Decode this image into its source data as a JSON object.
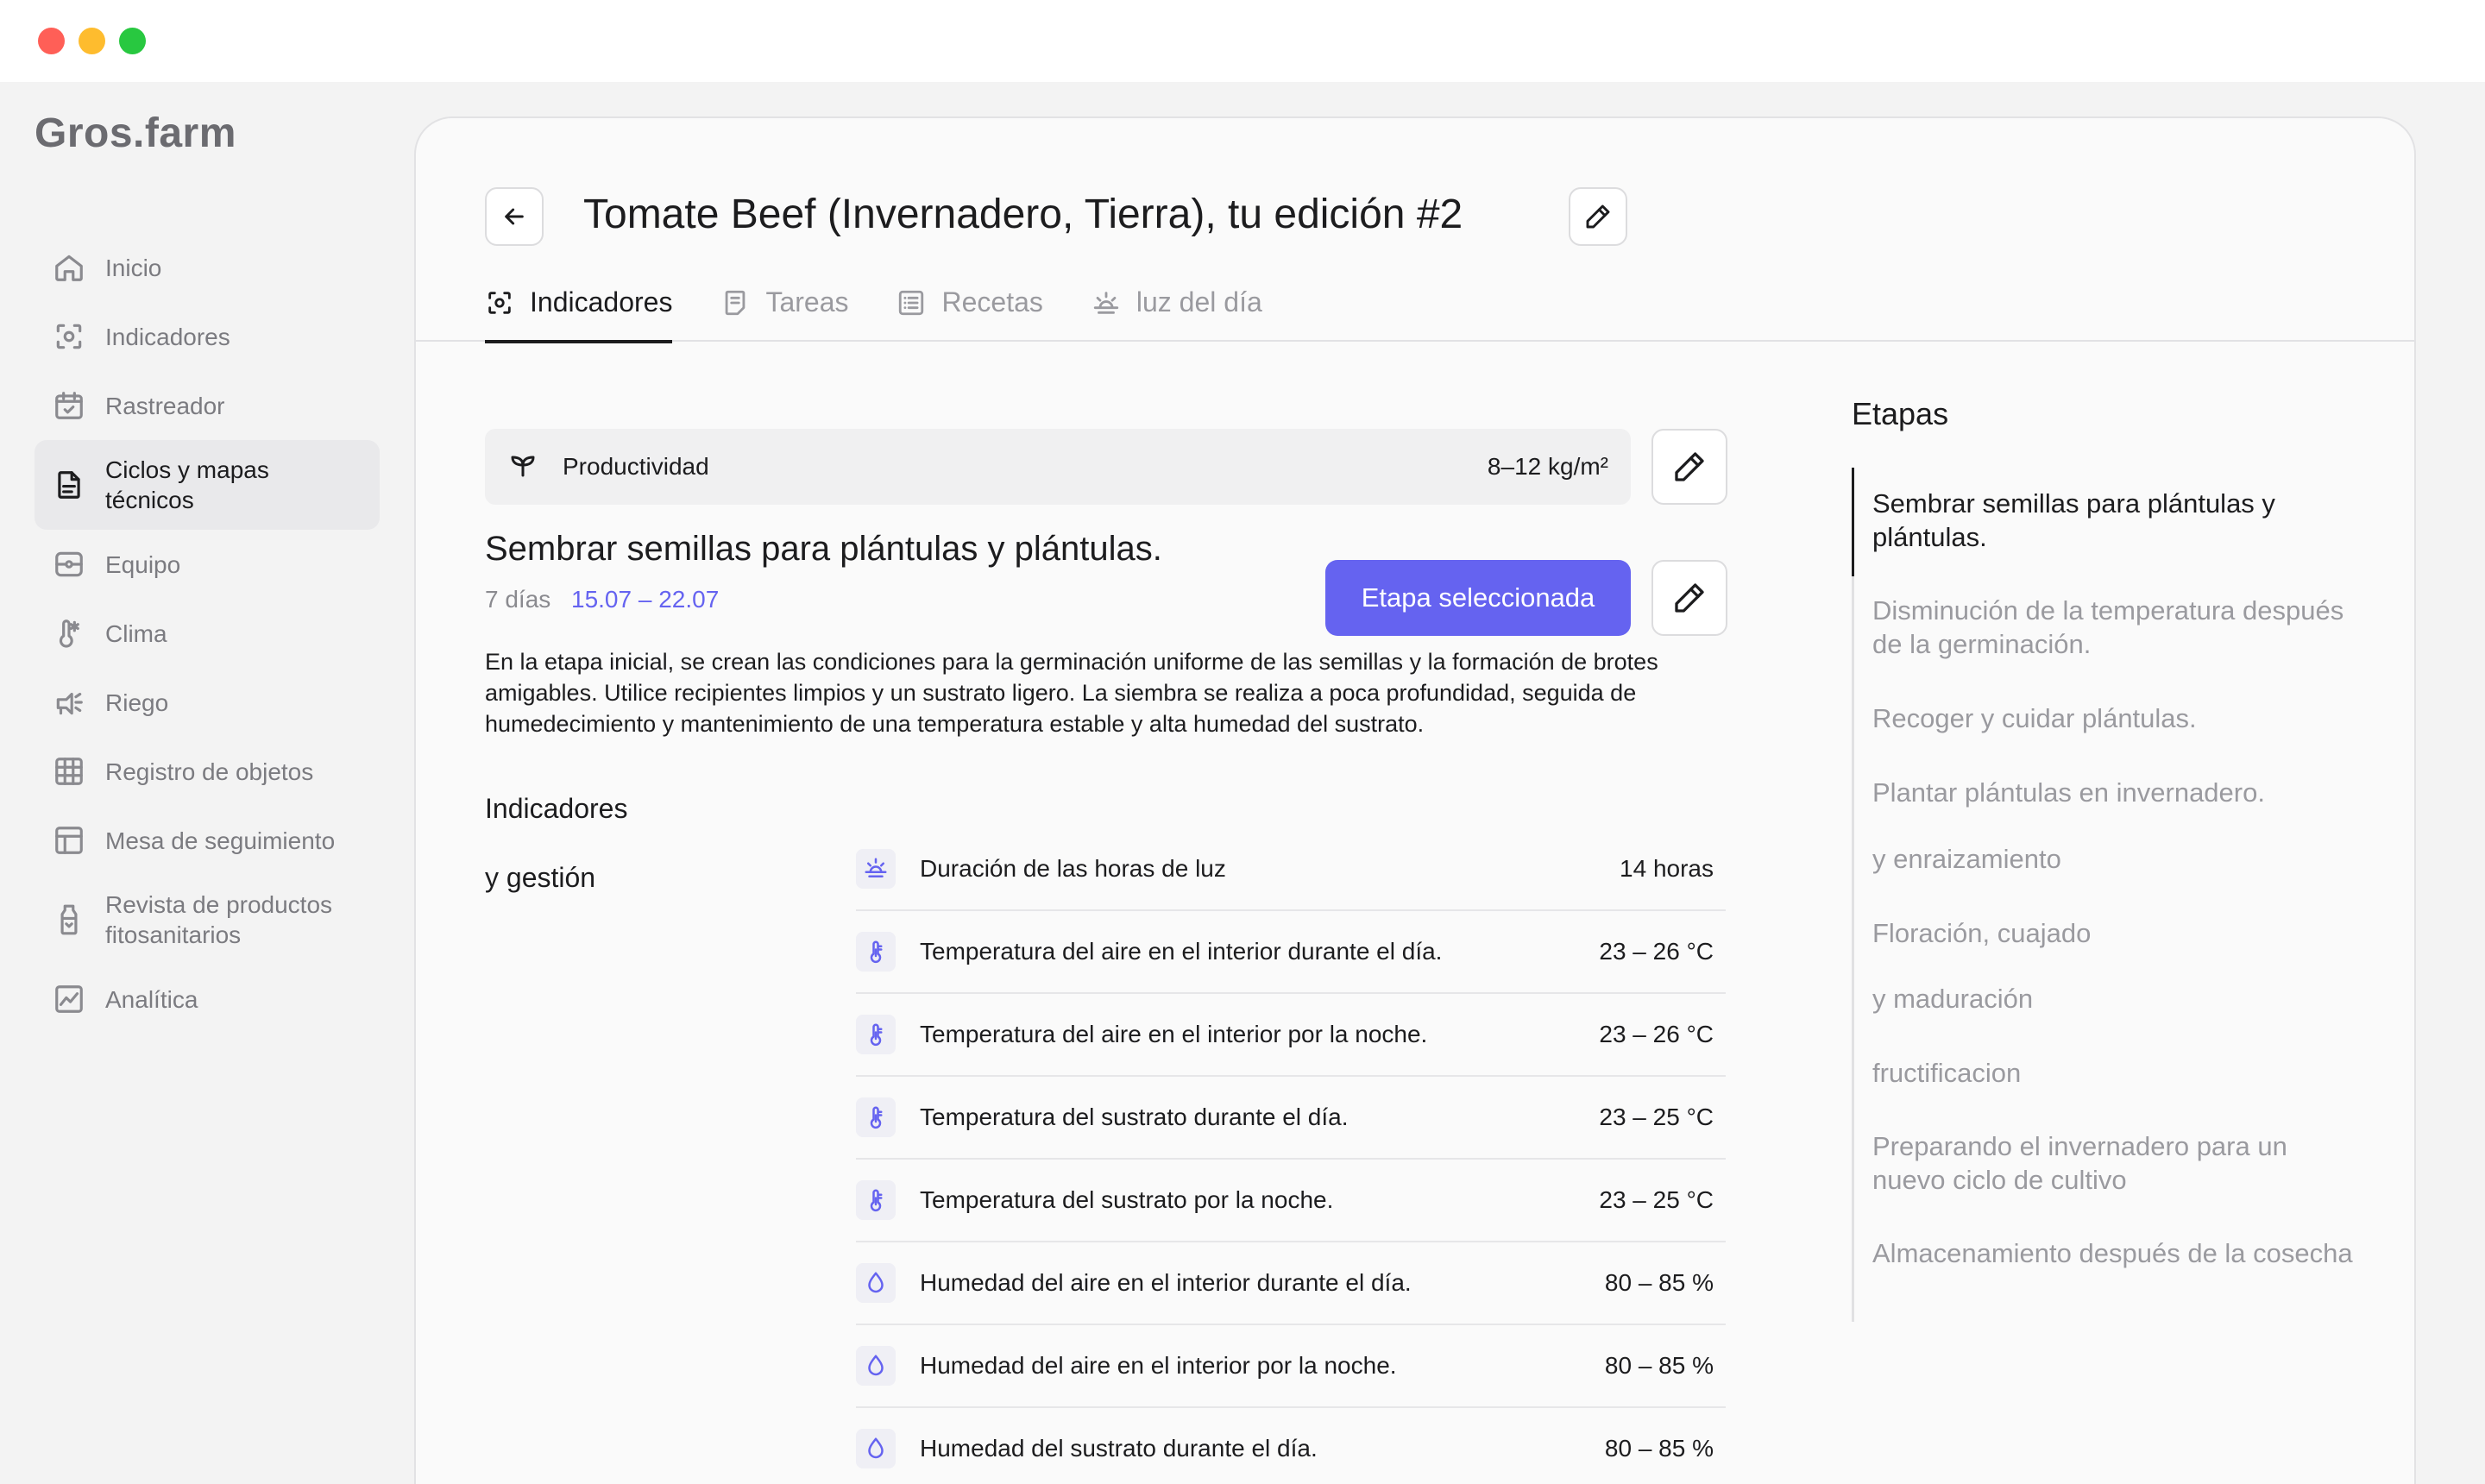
{
  "app": {
    "logo": "Gros.farm"
  },
  "sidebar": {
    "items": [
      {
        "label": "Inicio",
        "icon": "home-icon"
      },
      {
        "label": "Indicadores",
        "icon": "indicators-icon"
      },
      {
        "label": "Rastreador",
        "icon": "calendar-check-icon"
      },
      {
        "label": "Ciclos y mapas técnicos",
        "icon": "document-icon",
        "active": true
      },
      {
        "label": "Equipo",
        "icon": "equipment-icon"
      },
      {
        "label": "Clima",
        "icon": "thermometer-snow-icon"
      },
      {
        "label": "Riego",
        "icon": "watering-icon"
      },
      {
        "label": "Registro de objetos",
        "icon": "grid-icon"
      },
      {
        "label": "Mesa de seguimiento",
        "icon": "table-icon"
      },
      {
        "label": "Revista de productos fitosanitarios",
        "icon": "bottle-icon"
      },
      {
        "label": "Analítica",
        "icon": "chart-icon"
      }
    ]
  },
  "header": {
    "title": "Tomate Beef (Invernadero, Tierra), tu edición #2",
    "tabs": [
      {
        "label": "Indicadores",
        "icon": "indicators-icon",
        "active": true
      },
      {
        "label": "Tareas",
        "icon": "tasks-icon"
      },
      {
        "label": "Recetas",
        "icon": "list-icon"
      },
      {
        "label": "luz del día",
        "icon": "daylight-icon"
      }
    ]
  },
  "productivity": {
    "label": "Productividad",
    "value": "8–12 kg/m²"
  },
  "stage": {
    "title": "Sembrar semillas para plántulas y plántulas.",
    "days": "7 días",
    "dates": "15.07 – 22.07",
    "button_label": "Etapa seleccionada",
    "description": "En la etapa inicial, se crean las condiciones para la germinación uniforme de las semillas y la formación de brotes amigables. Utilice recipientes limpios y un sustrato ligero. La siembra se realiza a poca profundidad, seguida de humedecimiento y mantenimiento de una temperatura estable y alta humedad del sustrato.",
    "indicators_label_1": "Indicadores",
    "indicators_label_2": "y gestión",
    "indicators": [
      {
        "name": "Duración de las horas de luz",
        "value": "14 horas",
        "icon": "sun-icon"
      },
      {
        "name": "Temperatura del aire en el interior durante el día.",
        "value": "23 – 26 °C",
        "icon": "thermometer-icon"
      },
      {
        "name": "Temperatura del aire en el interior por la noche.",
        "value": "23 – 26 °C",
        "icon": "thermometer-icon"
      },
      {
        "name": "Temperatura del sustrato durante el día.",
        "value": "23 – 25 °C",
        "icon": "thermometer-icon"
      },
      {
        "name": "Temperatura del sustrato por la noche.",
        "value": "23 – 25 °C",
        "icon": "thermometer-icon"
      },
      {
        "name": "Humedad del aire en el interior durante el día.",
        "value": "80 – 85 %",
        "icon": "drop-icon"
      },
      {
        "name": "Humedad del aire en el interior por la noche.",
        "value": "80 – 85 %",
        "icon": "drop-icon"
      },
      {
        "name": "Humedad del sustrato durante el día.",
        "value": "80 – 85 %",
        "icon": "drop-icon"
      }
    ]
  },
  "stages": {
    "title": "Etapas",
    "items": [
      {
        "label": "Sembrar semillas para plántulas y plántulas.",
        "active": true
      },
      {
        "label": "Disminución de la temperatura después de la germinación."
      },
      {
        "label": "Recoger y cuidar plántulas."
      },
      {
        "label": "Plantar plántulas en invernadero."
      },
      {
        "label": "y enraizamiento"
      },
      {
        "label": "Floración, cuajado"
      },
      {
        "label": "y maduración"
      },
      {
        "label": "fructificacion"
      },
      {
        "label": "Preparando el invernadero para un nuevo ciclo de cultivo"
      },
      {
        "label": "Almacenamiento después de la cosecha"
      }
    ]
  },
  "colors": {
    "accent": "#6563f0",
    "text": "#1c1c1e",
    "muted": "#9a9a9f"
  }
}
